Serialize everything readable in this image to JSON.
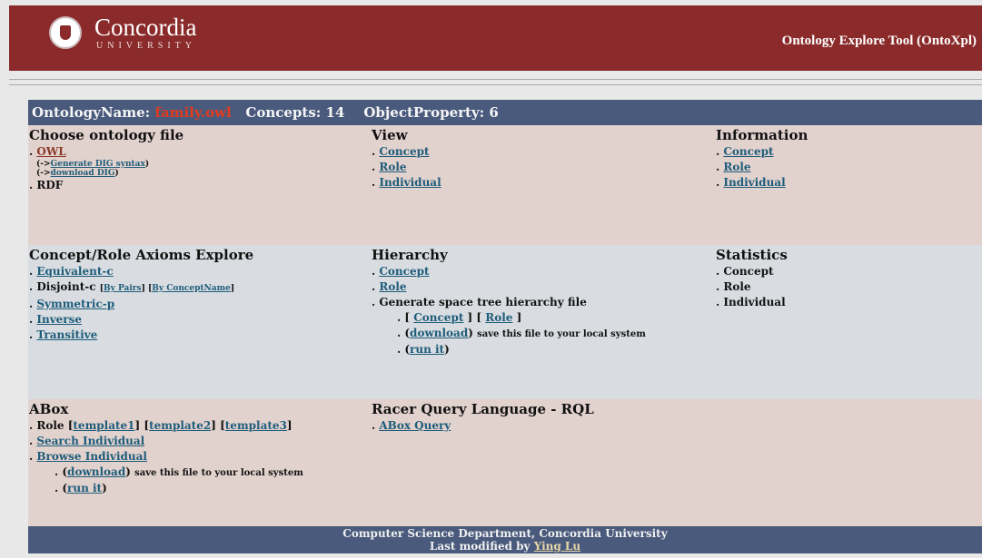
{
  "header": {
    "logo_name": "Concordia",
    "logo_sub": "UNIVERSITY",
    "app_title": "Ontology Explore Tool (OntoXpl)"
  },
  "topbar": {
    "ontology_label": "OntologyName:",
    "ontology_file": "family.owl",
    "concepts_label": "Concepts: 14",
    "objprop_label": "ObjectProperty: 6"
  },
  "choose_file": {
    "title": "Choose ontology file",
    "owl": "OWL",
    "gen_prefix": "(->",
    "gen_dig": "Generate DIG syntax",
    "gen_suffix": ")",
    "dl_prefix": "(->",
    "dl_dig": "download DIG",
    "dl_suffix": ")",
    "rdf": "RDF"
  },
  "view": {
    "title": "View",
    "concept": "Concept",
    "role": "Role",
    "individual": "Individual"
  },
  "information": {
    "title": "Information",
    "concept": "Concept",
    "role": "Role",
    "individual": "Individual"
  },
  "axioms": {
    "title": "Concept/Role Axioms Explore",
    "equivalent": "Equivalent-c",
    "disjoint": "Disjoint-c",
    "by_pairs": "By Pairs",
    "by_conceptname": "By ConceptName",
    "symmetric": "Symmetric-p",
    "inverse": "Inverse",
    "transitive": "Transitive"
  },
  "hierarchy": {
    "title": "Hierarchy",
    "concept": "Concept",
    "role": "Role",
    "generate": "Generate space tree hierarchy file",
    "gen_concept": "Concept",
    "gen_role": "Role",
    "download": "download",
    "save_text": "save this file to your local system",
    "run_it": "run it"
  },
  "statistics": {
    "title": "Statistics",
    "concept": "Concept",
    "role": "Role",
    "individual": "Individual"
  },
  "abox": {
    "title": "ABox",
    "role_label": "Role",
    "template1": "template1",
    "template2": "template2",
    "template3": "template3",
    "search": "Search Individual",
    "browse": "Browse Individual",
    "download": "download",
    "save_text": "save this file to your local system",
    "run_it": "run it"
  },
  "rql": {
    "title": "Racer Query Language - RQL",
    "abox_query": "ABox Query"
  },
  "footer": {
    "dept": "Computer Science Department, Concordia University",
    "modified_prefix": "Last modified by",
    "author": "Ying Lu"
  },
  "colors": {
    "header_bg": "#8b2a2a",
    "bar_bg": "#4a5a7c",
    "row_pink": "#e2d2ce",
    "row_blue": "#d9dde1",
    "link": "#1d5c7a",
    "file_name": "#e33b1e"
  }
}
